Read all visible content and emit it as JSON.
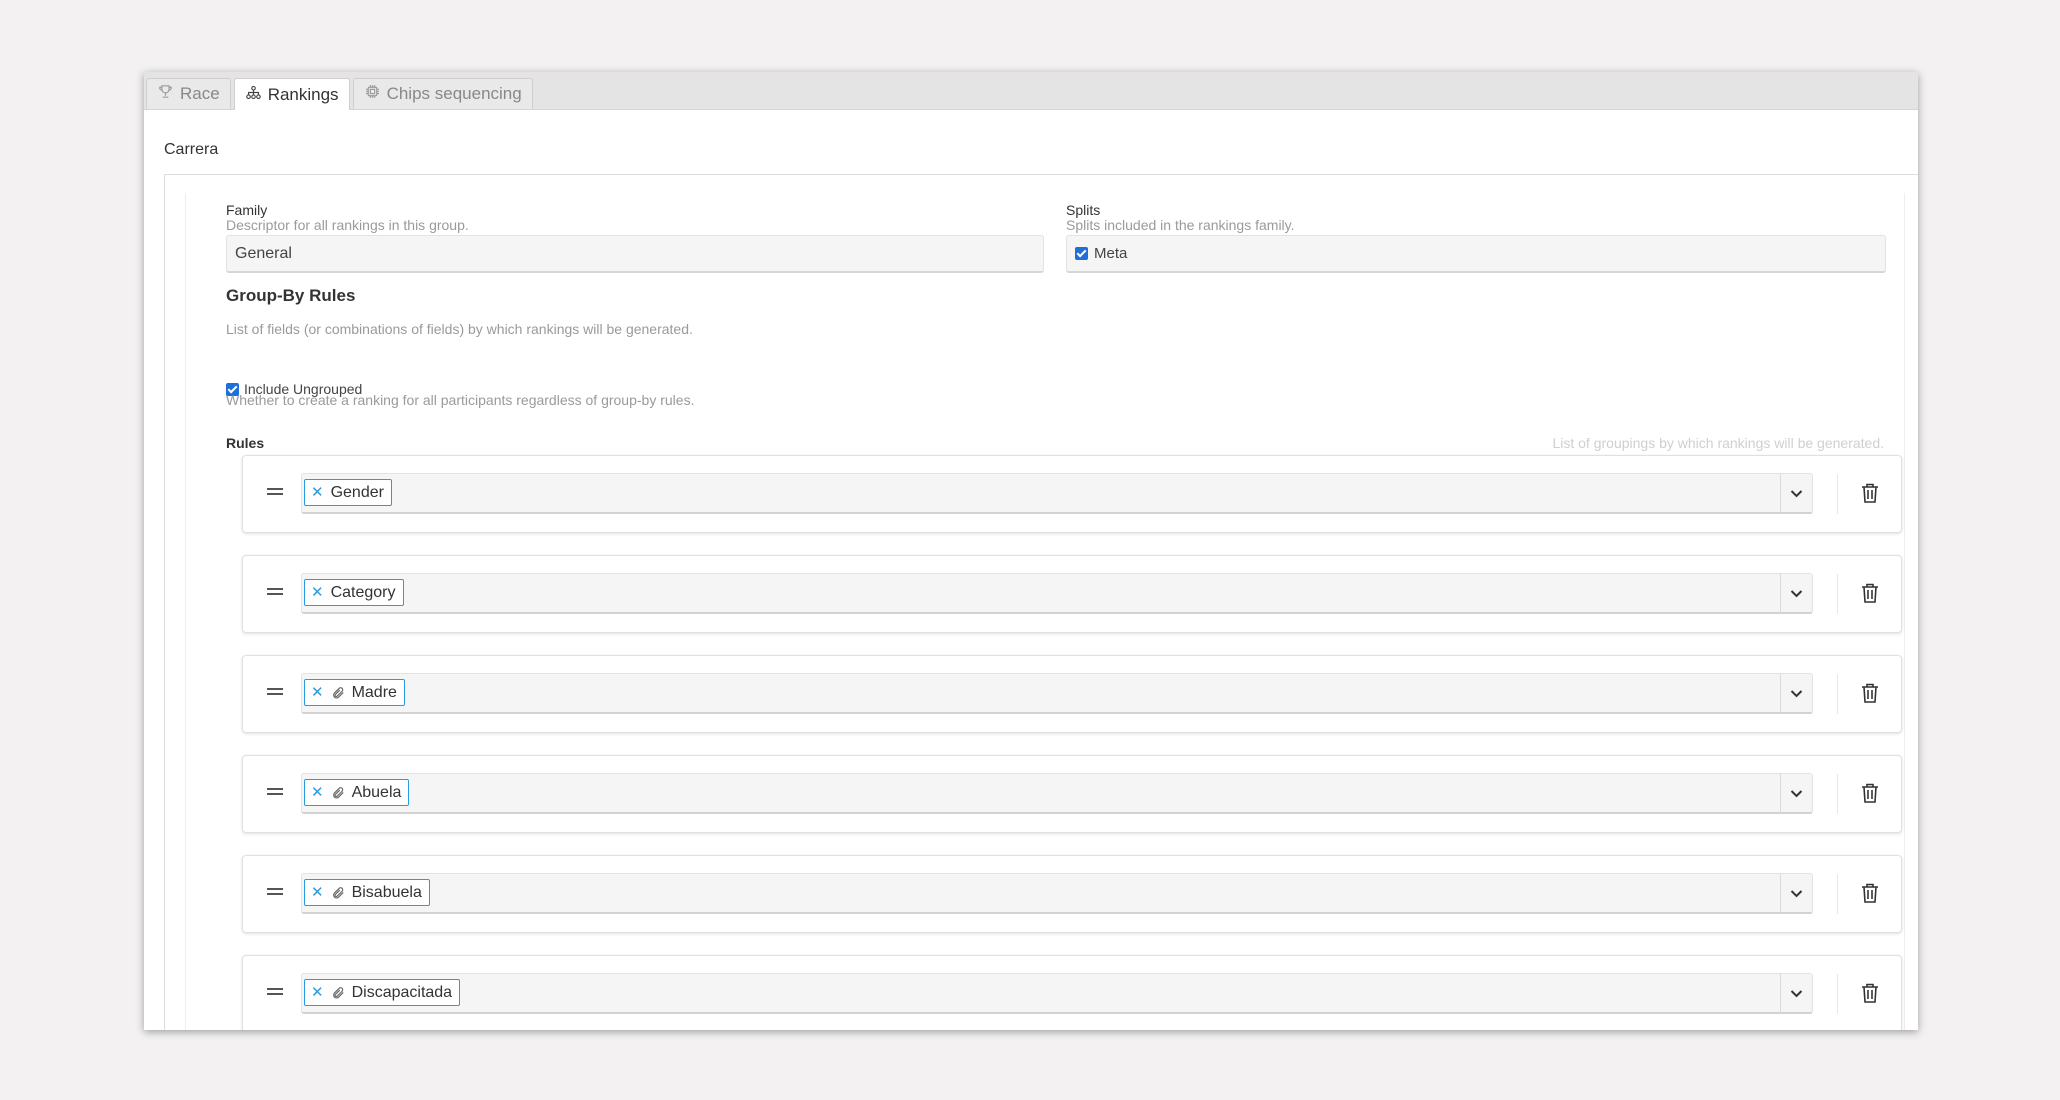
{
  "tabs": [
    {
      "label": "Race",
      "icon": "trophy-icon",
      "active": false
    },
    {
      "label": "Rankings",
      "icon": "hierarchy-icon",
      "active": true
    },
    {
      "label": "Chips sequencing",
      "icon": "chip-icon",
      "active": false
    }
  ],
  "section": {
    "title": "Carrera"
  },
  "family": {
    "label": "Family",
    "description": "Descriptor for all rankings in this group.",
    "value": "General"
  },
  "splits": {
    "label": "Splits",
    "description": "Splits included in the rankings family.",
    "option": "Meta",
    "checked": true
  },
  "group_by": {
    "title": "Group-By Rules",
    "description": "List of fields (or combinations of fields) by which rankings will be generated.",
    "include_ungrouped": {
      "label": "Include Ungrouped",
      "description": "Whether to create a ranking for all participants regardless of group-by rules.",
      "checked": true
    },
    "rules_label": "Rules",
    "rules_hint": "List of groupings by which rankings will be generated.",
    "rules": [
      {
        "chip": "Gender",
        "attachment": false
      },
      {
        "chip": "Category",
        "attachment": false
      },
      {
        "chip": "Madre",
        "attachment": true
      },
      {
        "chip": "Abuela",
        "attachment": true
      },
      {
        "chip": "Bisabuela",
        "attachment": true
      },
      {
        "chip": "Discapacitada",
        "attachment": true
      }
    ]
  },
  "colors": {
    "accent": "#2a9be0",
    "checkbox": "#1e6fd9"
  }
}
